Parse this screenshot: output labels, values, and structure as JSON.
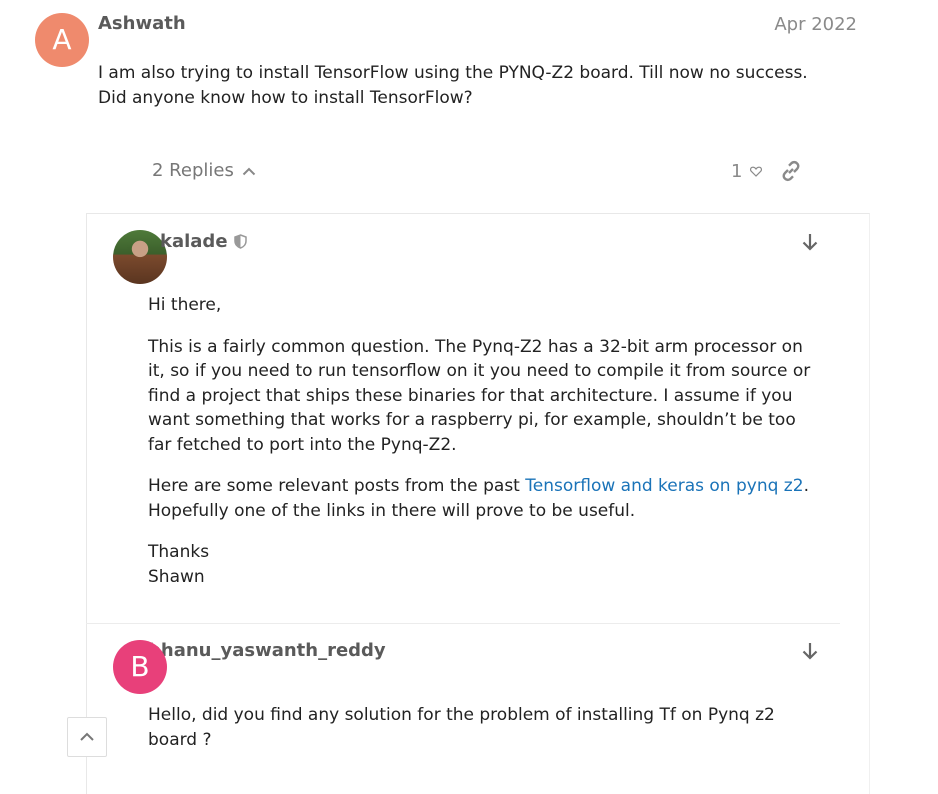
{
  "post": {
    "avatar_letter": "A",
    "avatar_color": "#ef8a6d",
    "username": "Ashwath",
    "date": "Apr 2022",
    "text_line1": "I am also trying to install TensorFlow using the PYNQ-Z2 board. Till now no success.",
    "text_line2": "Did anyone know how to install TensorFlow?",
    "replies_label": "2 Replies",
    "like_count": "1"
  },
  "reply1": {
    "username": "kalade",
    "greeting": "Hi there,",
    "para1": "This is a fairly common question. The Pynq-Z2 has a 32-bit arm processor on it, so if you need to run tensorflow on it you need to compile it from source or find a project that ships these binaries for that architecture. I assume if you want something that works for a raspberry pi, for example, shouldn’t be too far fetched to port into the Pynq-Z2.",
    "para2_before": "Here are some relevant posts from the past ",
    "para2_link": "Tensorflow and keras on pynq z2",
    "para2_after": ". Hopefully one of the links in there will prove to be useful.",
    "thanks": "Thanks",
    "signature": "Shawn"
  },
  "reply2": {
    "avatar_letter": "B",
    "avatar_color": "#e8407a",
    "username": "bhanu_yaswanth_reddy",
    "text": "Hello, did you find any solution for the problem of installing Tf on Pynq z2 board ?"
  },
  "colors": {
    "link": "#1a73b8",
    "meta": "#8a8a8a"
  }
}
